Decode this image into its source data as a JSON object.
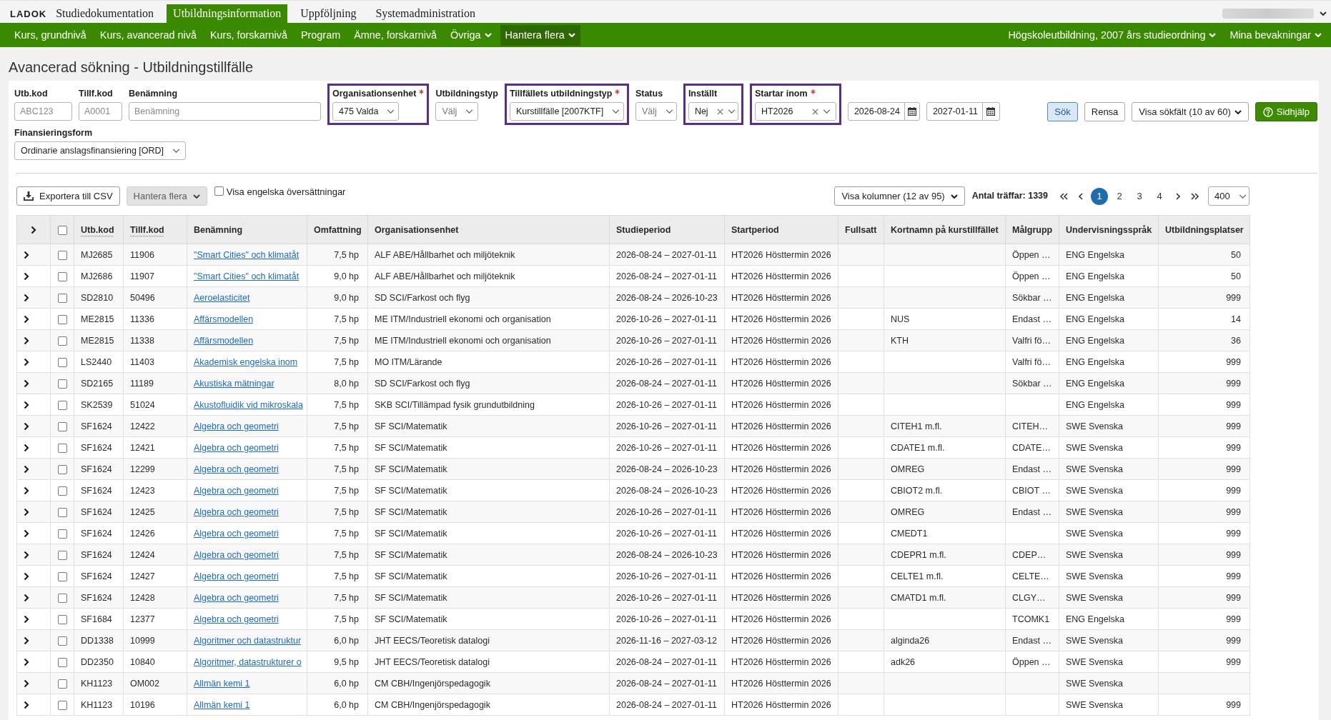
{
  "app_bar": {
    "logo": "LADOK",
    "tabs": [
      {
        "label": "Studiedokumentation",
        "selected": false
      },
      {
        "label": "Utbildningsinformation",
        "selected": true
      },
      {
        "label": "Uppföljning",
        "selected": false
      },
      {
        "label": "Systemadministration",
        "selected": false
      }
    ]
  },
  "nav": {
    "items": [
      {
        "label": "Kurs, grundnivå",
        "selected": false,
        "dropdown": false
      },
      {
        "label": "Kurs, avancerad nivå",
        "selected": false,
        "dropdown": false
      },
      {
        "label": "Kurs, forskarnivå",
        "selected": false,
        "dropdown": false
      },
      {
        "label": "Program",
        "selected": false,
        "dropdown": false
      },
      {
        "label": "Ämne, forskarnivå",
        "selected": false,
        "dropdown": false
      },
      {
        "label": "Övriga",
        "selected": false,
        "dropdown": true
      },
      {
        "label": "Hantera flera",
        "selected": true,
        "dropdown": true
      }
    ],
    "right_items": [
      {
        "label": "Högskoleutbildning, 2007 års studieordning",
        "selected": false,
        "dropdown": true
      },
      {
        "label": "Mina bevakningar",
        "selected": false,
        "dropdown": true
      }
    ]
  },
  "page_title": "Avancerad sökning - Utbildningstillfälle",
  "filters": {
    "rows": [
      {
        "fields": [
          {
            "kind": "text",
            "label": "Utb.kod",
            "placeholder": "ABC123",
            "required": false,
            "highlighted": false,
            "clearable": false
          },
          {
            "kind": "text",
            "label": "Tillf.kod",
            "placeholder": "A0001",
            "required": false,
            "highlighted": false,
            "clearable": false
          },
          {
            "kind": "text",
            "label": "Benämning",
            "placeholder": "Benämning",
            "required": false,
            "highlighted": false,
            "clearable": false
          },
          {
            "kind": "select",
            "label": "Organisationsenhet",
            "value": "475 Valda",
            "required": true,
            "highlighted": true,
            "clearable": false
          },
          {
            "kind": "select",
            "label": "Utbildningstyp",
            "placeholder": "Välj",
            "required": false,
            "highlighted": false,
            "clearable": false
          },
          {
            "kind": "select",
            "label": "Tillfällets utbildningstyp",
            "value": "Kurstillfälle [2007KTF]",
            "required": true,
            "highlighted": true,
            "clearable": false
          },
          {
            "kind": "select",
            "label": "Status",
            "placeholder": "Välj",
            "required": false,
            "highlighted": false,
            "clearable": false
          },
          {
            "kind": "select",
            "label": "Inställt",
            "value": "Nej",
            "required": false,
            "highlighted": true,
            "clearable": true
          },
          {
            "kind": "select",
            "label": "Startar inom",
            "value": "HT2026",
            "required": true,
            "highlighted": true,
            "clearable": true
          },
          {
            "kind": "date",
            "value": "2026-08-24",
            "required": false,
            "highlighted": false,
            "clearable": false
          },
          {
            "kind": "date",
            "value": "2027-01-11",
            "required": false,
            "highlighted": false,
            "clearable": false
          }
        ]
      },
      {
        "fields": [
          {
            "kind": "select",
            "label": "Finansieringsform",
            "value": "Ordinarie anslagsfinansiering [ORD]",
            "required": false,
            "highlighted": false,
            "clearable": false
          }
        ]
      }
    ],
    "actions": [
      {
        "kind": "search",
        "label": "Sök"
      },
      {
        "kind": "reset",
        "label": "Rensa"
      },
      {
        "kind": "dropdown",
        "label": "Visa sökfält (10 av 60)"
      },
      {
        "kind": "help",
        "label": "Sidhjälp"
      }
    ]
  },
  "toolbar": {
    "buttons": [
      {
        "kind": "export",
        "label": "Exportera till CSV",
        "disabled": false
      },
      {
        "kind": "menu",
        "label": "Hantera flera",
        "disabled": true
      }
    ],
    "translations_toggle": {
      "label": "Visa engelska översättningar",
      "checked": false
    },
    "columns_button": {
      "label": "Visa kolumner (12 av 95)"
    },
    "hit_count": "Antal träffar: 1339",
    "pages": [
      {
        "label": "1",
        "selected": true
      },
      {
        "label": "2",
        "selected": false
      },
      {
        "label": "3",
        "selected": false
      },
      {
        "label": "4",
        "selected": false
      }
    ],
    "page_size": {
      "value": "400"
    }
  },
  "table": {
    "header": {
      "expanded": false,
      "checked": false
    },
    "columns": [
      {
        "label": "Utb.kod",
        "kind": "text",
        "abbreviation": true
      },
      {
        "label": "Tillf.kod",
        "kind": "text",
        "abbreviation": true
      },
      {
        "label": "Benämning",
        "kind": "link",
        "abbreviation": false
      },
      {
        "label": "Omfattning",
        "kind": "number",
        "abbreviation": false
      },
      {
        "label": "Organisationsenhet",
        "kind": "text",
        "abbreviation": false
      },
      {
        "label": "Studieperiod",
        "kind": "text",
        "abbreviation": false
      },
      {
        "label": "Startperiod",
        "kind": "text",
        "abbreviation": false
      },
      {
        "label": "Fullsatt",
        "kind": "text",
        "abbreviation": false
      },
      {
        "label": "Kortnamn på kurstillfället",
        "kind": "text",
        "abbreviation": false
      },
      {
        "label": "Målgrupp",
        "kind": "text",
        "abbreviation": false
      },
      {
        "label": "Undervisningsspråk",
        "kind": "text",
        "abbreviation": false
      },
      {
        "label": "Utbildningsplatser",
        "kind": "number",
        "abbreviation": false
      }
    ],
    "rows": [
      {
        "expanded": false,
        "checked": false,
        "utb_kod": "MJ2685",
        "tillf_kod": "11906",
        "benamning": "\"Smart Cities\" och klimatåt",
        "omfattning": "7,5 hp",
        "organisationsenhet": "ALF ABE/Hållbarhet och miljöteknik",
        "studieperiod": "2026-08-24 – 2027-01-11",
        "startperiod": "HT2026 Hösttermin 2026",
        "malgrupp": "Öppen …",
        "undervisningssprak": "ENG Engelska",
        "utbildningsplatser": "50"
      },
      {
        "expanded": false,
        "checked": false,
        "utb_kod": "MJ2686",
        "tillf_kod": "11907",
        "benamning": "\"Smart Cities\" och klimatåt",
        "omfattning": "9,0 hp",
        "organisationsenhet": "ALF ABE/Hållbarhet och miljöteknik",
        "studieperiod": "2026-08-24 – 2027-01-11",
        "startperiod": "HT2026 Hösttermin 2026",
        "malgrupp": "Öppen …",
        "undervisningssprak": "ENG Engelska",
        "utbildningsplatser": "50"
      },
      {
        "expanded": false,
        "checked": false,
        "utb_kod": "SD2810",
        "tillf_kod": "50496",
        "benamning": "Aeroelasticitet",
        "omfattning": "9,0 hp",
        "organisationsenhet": "SD SCI/Farkost och flyg",
        "studieperiod": "2026-08-24 – 2026-10-23",
        "startperiod": "HT2026 Hösttermin 2026",
        "malgrupp": "Sökbar …",
        "undervisningssprak": "ENG Engelska",
        "utbildningsplatser": "999"
      },
      {
        "expanded": false,
        "checked": false,
        "utb_kod": "ME2815",
        "tillf_kod": "11336",
        "benamning": "Affärsmodellen",
        "omfattning": "7,5 hp",
        "organisationsenhet": "ME ITM/Industriell ekonomi och organisation",
        "studieperiod": "2026-10-26 – 2027-01-11",
        "startperiod": "HT2026 Hösttermin 2026",
        "kortnamn": "NUS",
        "malgrupp": "Endast …",
        "undervisningssprak": "ENG Engelska",
        "utbildningsplatser": "14"
      },
      {
        "expanded": false,
        "checked": false,
        "utb_kod": "ME2815",
        "tillf_kod": "11338",
        "benamning": "Affärsmodellen",
        "omfattning": "7,5 hp",
        "organisationsenhet": "ME ITM/Industriell ekonomi och organisation",
        "studieperiod": "2026-10-26 – 2027-01-11",
        "startperiod": "HT2026 Hösttermin 2026",
        "kortnamn": "KTH",
        "malgrupp": "Valfri fö…",
        "undervisningssprak": "ENG Engelska",
        "utbildningsplatser": "36"
      },
      {
        "expanded": false,
        "checked": false,
        "utb_kod": "LS2440",
        "tillf_kod": "11403",
        "benamning": "Akademisk engelska inom",
        "omfattning": "7,5 hp",
        "organisationsenhet": "MO ITM/Lärande",
        "studieperiod": "2026-10-26 – 2027-01-11",
        "startperiod": "HT2026 Hösttermin 2026",
        "malgrupp": "Valfri fö…",
        "undervisningssprak": "ENG Engelska",
        "utbildningsplatser": "999"
      },
      {
        "expanded": false,
        "checked": false,
        "utb_kod": "SD2165",
        "tillf_kod": "11189",
        "benamning": "Akustiska mätningar",
        "omfattning": "8,0 hp",
        "organisationsenhet": "SD SCI/Farkost och flyg",
        "studieperiod": "2026-08-24 – 2027-01-11",
        "startperiod": "HT2026 Hösttermin 2026",
        "malgrupp": "Sökbar …",
        "undervisningssprak": "ENG Engelska",
        "utbildningsplatser": "999"
      },
      {
        "expanded": false,
        "checked": false,
        "utb_kod": "SK2539",
        "tillf_kod": "51024",
        "benamning": "Akustofluidik vid mikroskala",
        "omfattning": "7,5 hp",
        "organisationsenhet": "SKB SCI/Tillämpad fysik grundutbildning",
        "studieperiod": "2026-10-26 – 2027-01-11",
        "startperiod": "HT2026 Hösttermin 2026",
        "undervisningssprak": "ENG Engelska",
        "utbildningsplatser": "999"
      },
      {
        "expanded": false,
        "checked": false,
        "utb_kod": "SF1624",
        "tillf_kod": "12422",
        "benamning": "Algebra och geometri",
        "omfattning": "7,5 hp",
        "organisationsenhet": "SF SCI/Matematik",
        "studieperiod": "2026-10-26 – 2027-01-11",
        "startperiod": "HT2026 Hösttermin 2026",
        "kortnamn": "CITEH1 m.fl.",
        "malgrupp": "CITEH…",
        "undervisningssprak": "SWE Svenska",
        "utbildningsplatser": "999"
      },
      {
        "expanded": false,
        "checked": false,
        "utb_kod": "SF1624",
        "tillf_kod": "12421",
        "benamning": "Algebra och geometri",
        "omfattning": "7,5 hp",
        "organisationsenhet": "SF SCI/Matematik",
        "studieperiod": "2026-10-26 – 2027-01-11",
        "startperiod": "HT2026 Hösttermin 2026",
        "kortnamn": "CDATE1 m.fl.",
        "malgrupp": "CDATE…",
        "undervisningssprak": "SWE Svenska",
        "utbildningsplatser": "999"
      },
      {
        "expanded": false,
        "checked": false,
        "utb_kod": "SF1624",
        "tillf_kod": "12299",
        "benamning": "Algebra och geometri",
        "omfattning": "7,5 hp",
        "organisationsenhet": "SF SCI/Matematik",
        "studieperiod": "2026-08-24 – 2026-10-23",
        "startperiod": "HT2026 Hösttermin 2026",
        "kortnamn": "OMREG",
        "malgrupp": "Endast …",
        "undervisningssprak": "SWE Svenska",
        "utbildningsplatser": "999"
      },
      {
        "expanded": false,
        "checked": false,
        "utb_kod": "SF1624",
        "tillf_kod": "12423",
        "benamning": "Algebra och geometri",
        "omfattning": "7,5 hp",
        "organisationsenhet": "SF SCI/Matematik",
        "studieperiod": "2026-08-24 – 2026-10-23",
        "startperiod": "HT2026 Hösttermin 2026",
        "kortnamn": "CBIOT2 m.fl.",
        "malgrupp": "CBIOT …",
        "undervisningssprak": "SWE Svenska",
        "utbildningsplatser": "999"
      },
      {
        "expanded": false,
        "checked": false,
        "utb_kod": "SF1624",
        "tillf_kod": "12425",
        "benamning": "Algebra och geometri",
        "omfattning": "7,5 hp",
        "organisationsenhet": "SF SCI/Matematik",
        "studieperiod": "2026-10-26 – 2027-01-11",
        "startperiod": "HT2026 Hösttermin 2026",
        "kortnamn": "OMREG",
        "malgrupp": "Endast …",
        "undervisningssprak": "SWE Svenska",
        "utbildningsplatser": "999"
      },
      {
        "expanded": false,
        "checked": false,
        "utb_kod": "SF1624",
        "tillf_kod": "12426",
        "benamning": "Algebra och geometri",
        "omfattning": "7,5 hp",
        "organisationsenhet": "SF SCI/Matematik",
        "studieperiod": "2026-10-26 – 2027-01-11",
        "startperiod": "HT2026 Hösttermin 2026",
        "kortnamn": "CMEDT1",
        "undervisningssprak": "SWE Svenska",
        "utbildningsplatser": "999"
      },
      {
        "expanded": false,
        "checked": false,
        "utb_kod": "SF1624",
        "tillf_kod": "12424",
        "benamning": "Algebra och geometri",
        "omfattning": "7,5 hp",
        "organisationsenhet": "SF SCI/Matematik",
        "studieperiod": "2026-08-24 – 2026-10-23",
        "startperiod": "HT2026 Hösttermin 2026",
        "kortnamn": "CDEPR1 m.fl.",
        "malgrupp": "CDEP…",
        "undervisningssprak": "SWE Svenska",
        "utbildningsplatser": "999"
      },
      {
        "expanded": false,
        "checked": false,
        "utb_kod": "SF1624",
        "tillf_kod": "12427",
        "benamning": "Algebra och geometri",
        "omfattning": "7,5 hp",
        "organisationsenhet": "SF SCI/Matematik",
        "studieperiod": "2026-10-26 – 2027-01-11",
        "startperiod": "HT2026 Hösttermin 2026",
        "kortnamn": "CELTE1 m.fl.",
        "malgrupp": "CELTE…",
        "undervisningssprak": "SWE Svenska",
        "utbildningsplatser": "999"
      },
      {
        "expanded": false,
        "checked": false,
        "utb_kod": "SF1624",
        "tillf_kod": "12428",
        "benamning": "Algebra och geometri",
        "omfattning": "7,5 hp",
        "organisationsenhet": "SF SCI/Matematik",
        "studieperiod": "2026-10-26 – 2027-01-11",
        "startperiod": "HT2026 Hösttermin 2026",
        "kortnamn": "CMATD1 m.fl.",
        "malgrupp": "CLGY…",
        "undervisningssprak": "SWE Svenska",
        "utbildningsplatser": "999"
      },
      {
        "expanded": false,
        "checked": false,
        "utb_kod": "SF1684",
        "tillf_kod": "12377",
        "benamning": "Algebra och geometri",
        "omfattning": "7,5 hp",
        "organisationsenhet": "SF SCI/Matematik",
        "studieperiod": "2026-10-26 – 2027-01-11",
        "startperiod": "HT2026 Hösttermin 2026",
        "malgrupp": "TCOMK1",
        "undervisningssprak": "ENG Engelska",
        "utbildningsplatser": "999"
      },
      {
        "expanded": false,
        "checked": false,
        "utb_kod": "DD1338",
        "tillf_kod": "10999",
        "benamning": "Algoritmer och datastruktur",
        "omfattning": "6,0 hp",
        "organisationsenhet": "JHT EECS/Teoretisk datalogi",
        "studieperiod": "2026-11-16 – 2027-03-12",
        "startperiod": "HT2026 Hösttermin 2026",
        "kortnamn": "alginda26",
        "malgrupp": "Endast …",
        "undervisningssprak": "SWE Svenska",
        "utbildningsplatser": "999"
      },
      {
        "expanded": false,
        "checked": false,
        "utb_kod": "DD2350",
        "tillf_kod": "10840",
        "benamning": "Algoritmer, datastrukturer o",
        "omfattning": "9,5 hp",
        "organisationsenhet": "JHT EECS/Teoretisk datalogi",
        "studieperiod": "2026-08-24 – 2027-01-11",
        "startperiod": "HT2026 Hösttermin 2026",
        "kortnamn": "adk26",
        "malgrupp": "Öppen …",
        "undervisningssprak": "SWE Svenska",
        "utbildningsplatser": "999"
      },
      {
        "expanded": false,
        "checked": false,
        "utb_kod": "KH1123",
        "tillf_kod": "OM002",
        "benamning": "Allmän kemi 1",
        "omfattning": "6,0 hp",
        "organisationsenhet": "CM CBH/Ingenjörspedagogik",
        "studieperiod": "2026-08-24 – 2027-01-11",
        "startperiod": "HT2026 Hösttermin 2026",
        "undervisningssprak": "SWE Svenska"
      },
      {
        "expanded": false,
        "checked": false,
        "utb_kod": "KH1123",
        "tillf_kod": "10196",
        "benamning": "Allmän kemi 1",
        "omfattning": "6,0 hp",
        "organisationsenhet": "CM CBH/Ingenjörspedagogik",
        "studieperiod": "2026-08-24 – 2027-01-11",
        "startperiod": "HT2026 Hösttermin 2026",
        "undervisningssprak": "SWE Svenska",
        "utbildningsplatser": "999"
      }
    ]
  }
}
